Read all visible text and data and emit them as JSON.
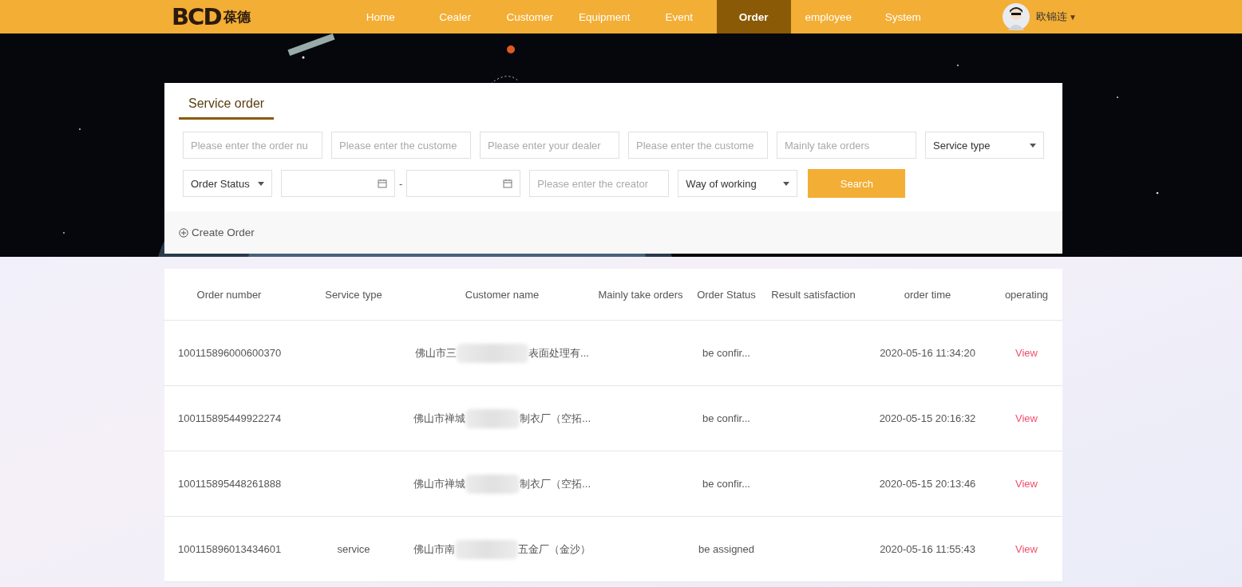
{
  "nav": {
    "logo": {
      "mark": "BCD",
      "name": "葆德"
    },
    "items": [
      {
        "label": "Home",
        "selected": false
      },
      {
        "label": "Cealer",
        "selected": false
      },
      {
        "label": "Customer",
        "selected": false
      },
      {
        "label": "Equipment",
        "selected": false
      },
      {
        "label": "Event",
        "selected": false
      },
      {
        "label": "Order",
        "selected": true
      },
      {
        "label": "employee",
        "selected": false
      },
      {
        "label": "System",
        "selected": false
      }
    ],
    "user": {
      "name": "欧锦连",
      "caret": "▼"
    }
  },
  "panel": {
    "tab": "Service order",
    "filters": [
      {
        "kind": "input",
        "placeholder": "Please enter the order nu"
      },
      {
        "kind": "input",
        "placeholder": "Please enter the custome"
      },
      {
        "kind": "input",
        "placeholder": "Please enter your dealer"
      },
      {
        "kind": "input",
        "placeholder": "Please enter the custome"
      },
      {
        "kind": "input",
        "placeholder": "Mainly take orders"
      },
      {
        "kind": "select",
        "value": "Service type"
      }
    ],
    "filters_2": [
      {
        "kind": "select",
        "value": "Order Status"
      },
      {
        "kind": "date"
      },
      {
        "kind": "sep",
        "text": "-"
      },
      {
        "kind": "date"
      },
      {
        "kind": "input",
        "placeholder": "Please enter the creator"
      },
      {
        "kind": "select",
        "value": "Way of working"
      },
      {
        "kind": "button",
        "text": "Search"
      }
    ],
    "create": "Create Order"
  },
  "table": {
    "columns": [
      "Order number",
      "Service type",
      "Customer name",
      "Mainly take orders",
      "Order Status",
      "Result satisfaction",
      "order time",
      "operating"
    ],
    "rows": [
      {
        "number": "100115896000600370",
        "customer_start": "佛山市三",
        "customer_end": "表面处理有...",
        "status": "be confir...",
        "time": "2020-05-16 11:34:20",
        "action": "View"
      },
      {
        "number": "100115895449922274",
        "customer_start": "佛山市禅城",
        "customer_end": "制衣厂（空拓...",
        "status": "be confir...",
        "time": "2020-05-15 20:16:32",
        "action": "View"
      },
      {
        "number": "100115895448261888",
        "customer_start": "佛山市禅城",
        "customer_end": "制衣厂（空拓...",
        "status": "be confir...",
        "time": "2020-05-15 20:13:46",
        "action": "View"
      },
      {
        "number": "100115896013434601",
        "service_type": "service",
        "customer_start": "佛山市南",
        "customer_end": "五金厂（金沙）",
        "status": "be assigned",
        "time": "2020-05-16 11:55:43",
        "action": "View"
      }
    ]
  }
}
